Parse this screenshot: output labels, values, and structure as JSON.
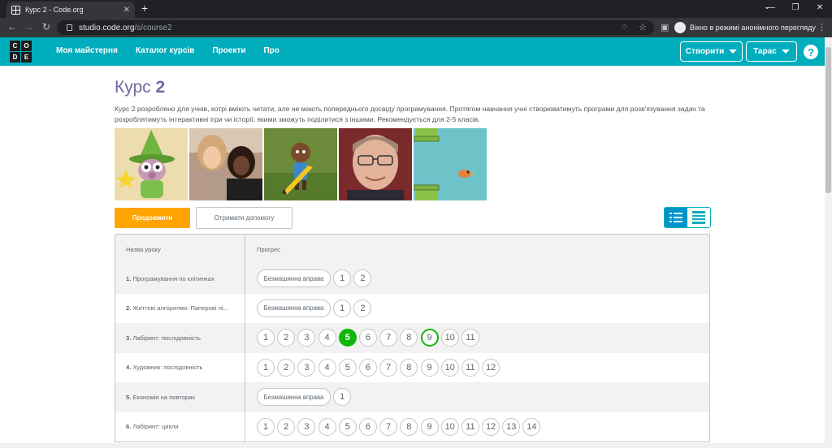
{
  "browser": {
    "tab_title": "Курс 2 - Code.org",
    "url_host": "studio.code.org",
    "url_path": "/s/course2",
    "incognito_label": "Вікно в режимі анонімного перегляду"
  },
  "header": {
    "logo_letters": [
      "C",
      "O",
      "D",
      "E"
    ],
    "nav": [
      "Моя майстерня",
      "Каталог курсів",
      "Проекти",
      "Про"
    ],
    "create_label": "Створити",
    "user_label": "Тарас",
    "help_label": "?"
  },
  "course": {
    "title_prefix": "Курс",
    "title_number": "2",
    "description": "Курс 2 розроблено для учнів, котрі вміють читати, але не мають попереднього досвіду програмування. Протягом навчання учні створюватимуть програми для розв'язування задач та розроблятимуть інтерактивні ігри чи історії, якими зможуть поділитися з іншими. Рекомендується для 2-5 класів.",
    "continue_label": "Продовжити",
    "help_label": "Отримати допомогу"
  },
  "colors": {
    "brand": "#00adbc",
    "title": "#7665a0",
    "continue": "#ffa400",
    "current_level": "#0eb807"
  },
  "table": {
    "col_name": "Назва уроку",
    "col_progress": "Прогрес",
    "rows": [
      {
        "num": "1.",
        "name": "Програмування по клітинках",
        "levels": [
          {
            "label": "Безмашинна вправа",
            "pill": true
          },
          {
            "label": "1"
          },
          {
            "label": "2"
          }
        ]
      },
      {
        "num": "2.",
        "name": "Життєві алгоритми: Паперові лі...",
        "levels": [
          {
            "label": "Безмашинна вправа",
            "pill": true
          },
          {
            "label": "1"
          },
          {
            "label": "2"
          }
        ]
      },
      {
        "num": "3.",
        "name": "Лабіринт: послідовність",
        "levels": [
          {
            "label": "1"
          },
          {
            "label": "2"
          },
          {
            "label": "3"
          },
          {
            "label": "4"
          },
          {
            "label": "5",
            "state": "current"
          },
          {
            "label": "6"
          },
          {
            "label": "7"
          },
          {
            "label": "8"
          },
          {
            "label": "9",
            "state": "attempted"
          },
          {
            "label": "10"
          },
          {
            "label": "11"
          }
        ]
      },
      {
        "num": "4.",
        "name": "Художник: послідовність",
        "levels": [
          {
            "label": "1"
          },
          {
            "label": "2"
          },
          {
            "label": "3"
          },
          {
            "label": "4"
          },
          {
            "label": "5"
          },
          {
            "label": "6"
          },
          {
            "label": "7"
          },
          {
            "label": "8"
          },
          {
            "label": "9"
          },
          {
            "label": "10"
          },
          {
            "label": "11"
          },
          {
            "label": "12"
          }
        ]
      },
      {
        "num": "5.",
        "name": "Економія на повторах",
        "levels": [
          {
            "label": "Безмашинна вправа",
            "pill": true
          },
          {
            "label": "1"
          }
        ]
      },
      {
        "num": "6.",
        "name": "Лабіринт: цикли",
        "levels": [
          {
            "label": "1"
          },
          {
            "label": "2"
          },
          {
            "label": "3"
          },
          {
            "label": "4"
          },
          {
            "label": "5"
          },
          {
            "label": "6"
          },
          {
            "label": "7"
          },
          {
            "label": "8"
          },
          {
            "label": "9"
          },
          {
            "label": "10"
          },
          {
            "label": "11"
          },
          {
            "label": "12"
          },
          {
            "label": "13"
          },
          {
            "label": "14"
          }
        ]
      }
    ]
  }
}
